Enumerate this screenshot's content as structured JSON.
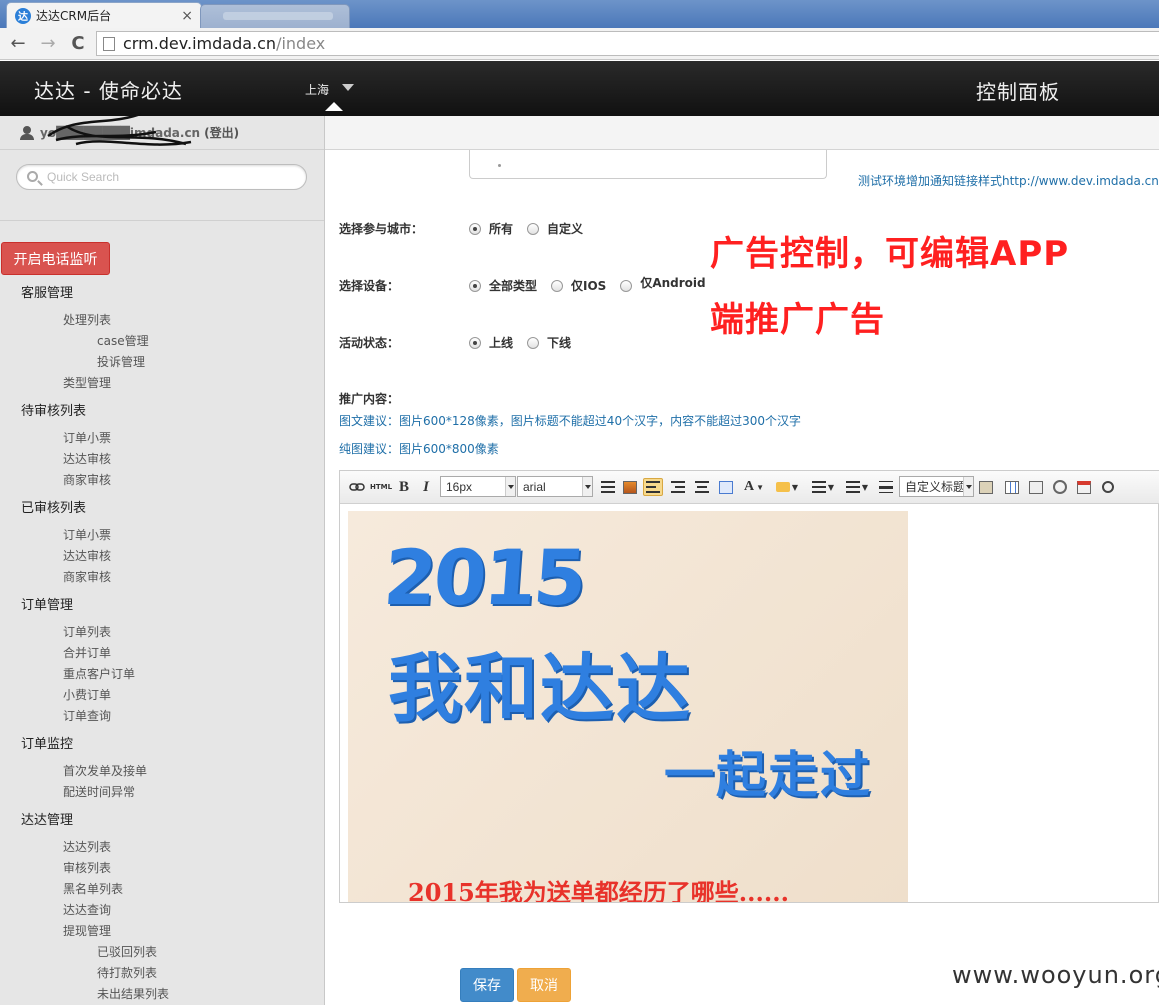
{
  "browser": {
    "tab_title": "达达CRM后台",
    "tab_favicon": "达",
    "tab_close": "×",
    "url_host": "crm.dev.imdada.cn",
    "url_path": "/index",
    "back": "←",
    "forward": "→",
    "reload": "C"
  },
  "header": {
    "brand": "达达 - 使命必达",
    "city": "上海",
    "title": "控制面板"
  },
  "user": {
    "email": "yo████████imdada.cn",
    "logout": "(登出)"
  },
  "sidebar": {
    "search_placeholder": "Quick Search",
    "monitor_button": "开启电话监听",
    "menu": [
      {
        "label": "客服管理",
        "level": 1
      },
      {
        "label": "处理列表",
        "level": 2
      },
      {
        "label": "case管理",
        "level": 3
      },
      {
        "label": "投诉管理",
        "level": 3
      },
      {
        "label": "类型管理",
        "level": 2
      },
      {
        "label": "待审核列表",
        "level": 1
      },
      {
        "label": "订单小票",
        "level": 2
      },
      {
        "label": "达达审核",
        "level": 2
      },
      {
        "label": "商家审核",
        "level": 2
      },
      {
        "label": "已审核列表",
        "level": 1
      },
      {
        "label": "订单小票",
        "level": 2
      },
      {
        "label": "达达审核",
        "level": 2
      },
      {
        "label": "商家审核",
        "level": 2
      },
      {
        "label": "订单管理",
        "level": 1
      },
      {
        "label": "订单列表",
        "level": 2
      },
      {
        "label": "合并订单",
        "level": 2
      },
      {
        "label": "重点客户订单",
        "level": 2
      },
      {
        "label": "小费订单",
        "level": 2
      },
      {
        "label": "订单查询",
        "level": 2
      },
      {
        "label": "订单监控",
        "level": 1
      },
      {
        "label": "首次发单及接单",
        "level": 2
      },
      {
        "label": "配送时间异常",
        "level": 2
      },
      {
        "label": "达达管理",
        "level": 1
      },
      {
        "label": "达达列表",
        "level": 2
      },
      {
        "label": "审核列表",
        "level": 2
      },
      {
        "label": "黑名单列表",
        "level": 2
      },
      {
        "label": "达达查询",
        "level": 2
      },
      {
        "label": "提现管理",
        "level": 2
      },
      {
        "label": "已驳回列表",
        "level": 3
      },
      {
        "label": "待打款列表",
        "level": 3
      },
      {
        "label": "未出结果列表",
        "level": 3
      }
    ]
  },
  "form": {
    "test_link": "测试环境增加通知链接样式http://www.dev.imdada.cn/act",
    "city_label": "选择参与城市：",
    "city_options": [
      "所有",
      "自定义"
    ],
    "device_label": "选择设备：",
    "device_options": [
      "全部类型",
      "仅IOS",
      "仅Android"
    ],
    "status_label": "活动状态：",
    "status_options": [
      "上线",
      "下线"
    ],
    "content_label": "推广内容：",
    "hint1": "图文建议：图片600*128像素，图片标题不能超过40个汉字，内容不能超过300个汉字",
    "hint2": "纯图建议：图片600*800像素",
    "save": "保存",
    "cancel": "取消"
  },
  "annotation": {
    "line1": "广告控制，可编辑APP",
    "line2": "端推广广告"
  },
  "editor": {
    "font_size": "16px",
    "font_family": "arial",
    "heading_select": "自定义标题",
    "html_label": "HTML",
    "bold": "B",
    "italic": "I",
    "font_color": "A"
  },
  "poster": {
    "year": "2015",
    "line1": "我和达达",
    "line2": "一起走过",
    "caption": "2015年我为送单都经历了哪些......"
  },
  "watermark": "www.wooyun.org"
}
